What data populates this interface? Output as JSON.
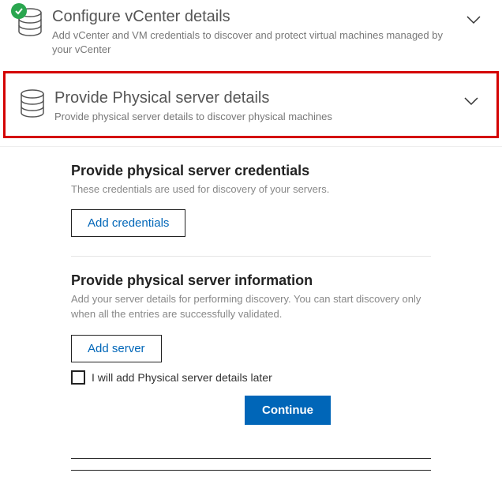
{
  "sections": {
    "vcenter": {
      "title": "Configure vCenter details",
      "desc": "Add vCenter and VM credentials to discover and protect virtual machines managed by your vCenter"
    },
    "physical": {
      "title": "Provide Physical server details",
      "desc": "Provide physical server details to discover physical machines"
    }
  },
  "detail": {
    "credentials": {
      "title": "Provide physical server credentials",
      "desc": "These credentials are used for discovery of your servers.",
      "button": "Add credentials"
    },
    "info": {
      "title": "Provide physical server information",
      "desc": "Add your server details for performing discovery. You can start discovery only when all the entries are successfully validated.",
      "button": "Add server"
    },
    "later_checkbox": "I will add Physical server details later",
    "continue": "Continue"
  }
}
